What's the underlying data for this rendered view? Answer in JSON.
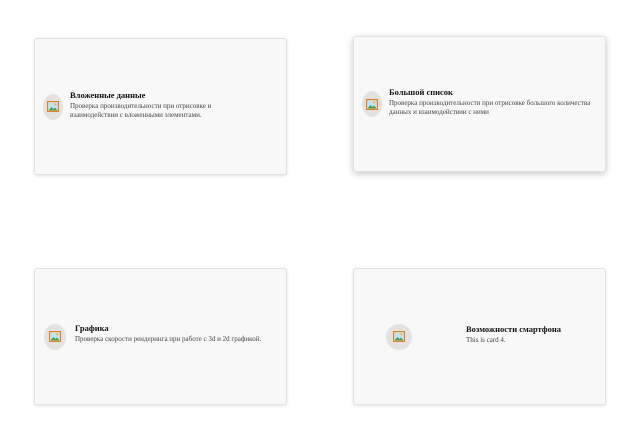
{
  "cards": [
    {
      "title": "Вложенные данные",
      "description": "Проверка производительности при отрисовке и взаимодействии с вложенными элементами.",
      "icon": "image-placeholder-icon"
    },
    {
      "title": "Большой список",
      "description": "Проверка производительности при отрисовке большого количества данных и взаимодействии с ними",
      "icon": "image-placeholder-icon"
    },
    {
      "title": "Графика",
      "description": "Проверка скорости рендеринга при работе с 3d и 2d графикой.",
      "icon": "image-placeholder-icon"
    },
    {
      "title": "Возможности смартфона",
      "description": "This is card 4.",
      "icon": "image-placeholder-icon"
    }
  ],
  "colors": {
    "card_background": "#f8f8f8",
    "card_border": "#e2e2e2",
    "thumb_background": "#e4e2df"
  }
}
